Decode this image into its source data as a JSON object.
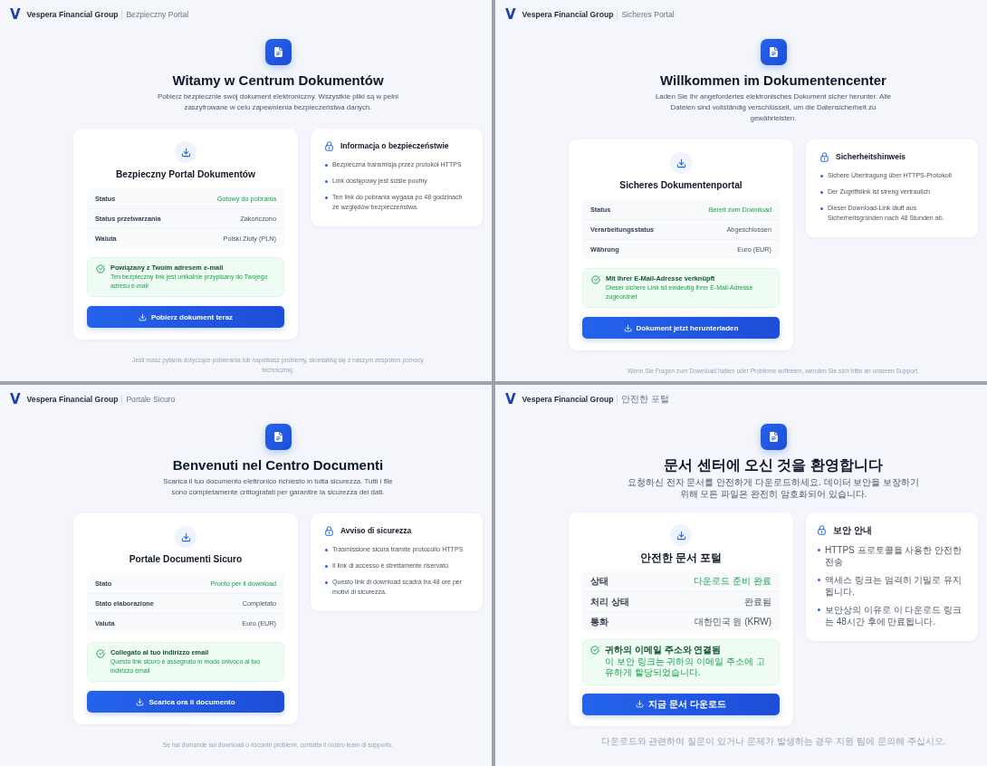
{
  "panels": [
    {
      "header": {
        "logo": "V",
        "brand": "Vespera Financial Group",
        "portal": "Bezpieczny Portal"
      },
      "hero": {
        "title": "Witamy w Centrum Dokumentów",
        "subtitle": "Pobierz bezpiecznie swój dokument elektroniczny. Wszystkie pliki są w pełni zaszyfrowane w celu zapewnienia bezpieczeństwa danych."
      },
      "download_card": {
        "title": "Bezpieczny Portal Dokumentów",
        "details": [
          {
            "label": "Status",
            "value": "Gotowy do pobrania",
            "kind": "status"
          },
          {
            "label": "Status przetwarzania",
            "value": "Zakończono",
            "kind": "text"
          },
          {
            "label": "Waluta",
            "value": "Polski Złoty (PLN)",
            "kind": "text"
          }
        ],
        "notice": {
          "title": "Powiązany z Twoim adresem e-mail",
          "text": "Ten bezpieczny link jest unikalnie przypisany do Twojego adresu e-mail"
        },
        "button": "Pobierz dokument teraz"
      },
      "security_card": {
        "title": "Informacja o bezpieczeństwie",
        "items": [
          "Bezpieczna transmisja przez protokół HTTPS",
          "Link dostępowy jest ściśle poufny",
          "Ten link do pobrania wygasa po 48 godzinach ze względów bezpieczeństwa."
        ]
      },
      "footer": "Jeśli masz pytania dotyczące pobierania lub napotkasz problemy, skontaktuj się z naszym zespołem pomocy technicznej."
    },
    {
      "header": {
        "logo": "V",
        "brand": "Vespera Financial Group",
        "portal": "Sicheres Portal"
      },
      "hero": {
        "title": "Willkommen im Dokumentencenter",
        "subtitle": "Laden Sie Ihr angefordertes elektronisches Dokument sicher herunter. Alle Dateien sind vollständig verschlüsselt, um die Datensicherheit zu gewährleisten."
      },
      "download_card": {
        "title": "Sicheres Dokumentenportal",
        "details": [
          {
            "label": "Status",
            "value": "Bereit zum Download",
            "kind": "status"
          },
          {
            "label": "Verarbeitungsstatus",
            "value": "Abgeschlossen",
            "kind": "text"
          },
          {
            "label": "Währung",
            "value": "Euro (EUR)",
            "kind": "text"
          }
        ],
        "notice": {
          "title": "Mit Ihrer E-Mail-Adresse verknüpft",
          "text": "Dieser sichere Link ist eindeutig Ihrer E-Mail-Adresse zugeordnet"
        },
        "button": "Dokument jetzt herunterladen"
      },
      "security_card": {
        "title": "Sicherheitshinweis",
        "items": [
          "Sichere Übertragung über HTTPS-Protokoll",
          "Der Zugriffslink ist streng vertraulich",
          "Dieser Download-Link läuft aus Sicherheitsgründen nach 48 Stunden ab."
        ]
      },
      "footer": "Wenn Sie Fragen zum Download haben oder Probleme auftreten, wenden Sie sich bitte an unseren Support."
    },
    {
      "header": {
        "logo": "V",
        "brand": "Vespera Financial Group",
        "portal": "Portale Sicuro"
      },
      "hero": {
        "title": "Benvenuti nel Centro Documenti",
        "subtitle": "Scarica il tuo documento elettronico richiesto in tutta sicurezza. Tutti i file sono completamente crittografati per garantire la sicurezza dei dati."
      },
      "download_card": {
        "title": "Portale Documenti Sicuro",
        "details": [
          {
            "label": "Stato",
            "value": "Pronto per il download",
            "kind": "status"
          },
          {
            "label": "Stato elaborazione",
            "value": "Completato",
            "kind": "text"
          },
          {
            "label": "Valuta",
            "value": "Euro (EUR)",
            "kind": "text"
          }
        ],
        "notice": {
          "title": "Collegato al tuo indirizzo email",
          "text": "Questo link sicuro è assegnato in modo univoco al tuo indirizzo email"
        },
        "button": "Scarica ora il documento"
      },
      "security_card": {
        "title": "Avviso di sicurezza",
        "items": [
          "Trasmissione sicura tramite protocollo HTTPS",
          "Il link di accesso è strettamente riservato",
          "Questo link di download scadrà tra 48 ore per motivi di sicurezza."
        ]
      },
      "footer": "Se hai domande sul download o riscontri problemi, contatta il nostro team di supporto."
    },
    {
      "header": {
        "logo": "V",
        "brand": "Vespera Financial Group",
        "portal": "안전한 포털"
      },
      "hero": {
        "title": "문서 센터에 오신 것을 환영합니다",
        "subtitle": "요청하신 전자 문서를 안전하게 다운로드하세요. 데이터 보안을 보장하기 위해 모든 파일은 완전히 암호화되어 있습니다."
      },
      "download_card": {
        "title": "안전한 문서 포털",
        "details": [
          {
            "label": "상태",
            "value": "다운로드 준비 완료",
            "kind": "status"
          },
          {
            "label": "처리 상태",
            "value": "완료됨",
            "kind": "text"
          },
          {
            "label": "통화",
            "value": "대한민국 원 (KRW)",
            "kind": "text"
          }
        ],
        "notice": {
          "title": "귀하의 이메일 주소와 연결됨",
          "text": "이 보안 링크는 귀하의 이메일 주소에 고유하게 할당되었습니다."
        },
        "button": "지금 문서 다운로드"
      },
      "security_card": {
        "title": "보안 안내",
        "items": [
          "HTTPS 프로토콜을 사용한 안전한 전송",
          "액세스 링크는 엄격히 기밀로 유지됩니다.",
          "보안상의 이유로 이 다운로드 링크는 48시간 후에 만료됩니다."
        ]
      },
      "footer": "다운로드와 관련하여 질문이 있거나 문제가 발생하는 경우 지원 팀에 문의해 주십시오."
    }
  ]
}
